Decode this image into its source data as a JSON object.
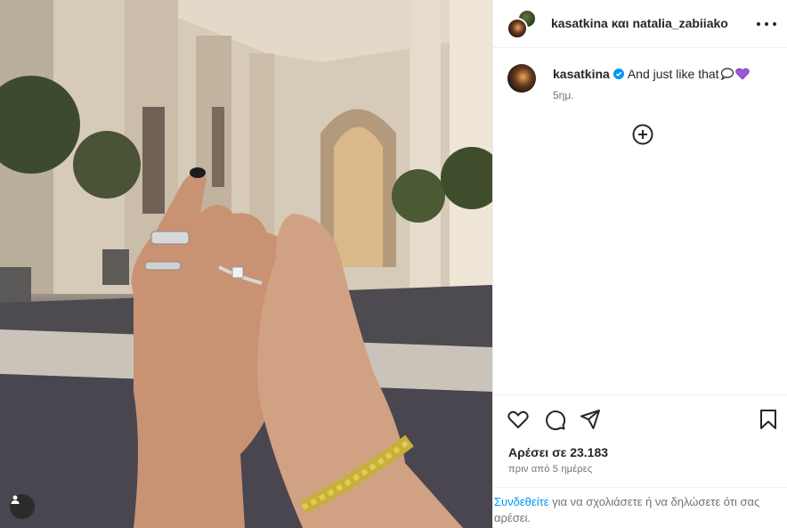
{
  "post": {
    "header_title": "kasatkina και natalia_zabiiako",
    "more_options_label": "",
    "caption": {
      "username": "kasatkina",
      "text": "And just like that",
      "time": "5ημ."
    },
    "likes_text": "Αρέσει σε 23.183",
    "date_text": "πριν από 5 ημέρες",
    "login_prompt": {
      "link_text": "Συνδεθείτε",
      "rest_text": " για να σχολιάσετε ή να δηλώσετε ότι σας αρέσει."
    }
  },
  "icons": {
    "verified": "verified-badge-icon",
    "speech": "speech-bubble-icon",
    "heart": "purple-heart-icon",
    "load_more": "plus-circle-icon",
    "like": "heart-outline-icon",
    "comment": "comment-icon",
    "share": "share-icon",
    "save": "bookmark-icon",
    "tagged_people": "person-icon"
  },
  "colors": {
    "link": "#0095f6",
    "verified": "#0095f6",
    "heart": "#9b59d6",
    "text": "#262626",
    "secondary": "#737373"
  }
}
